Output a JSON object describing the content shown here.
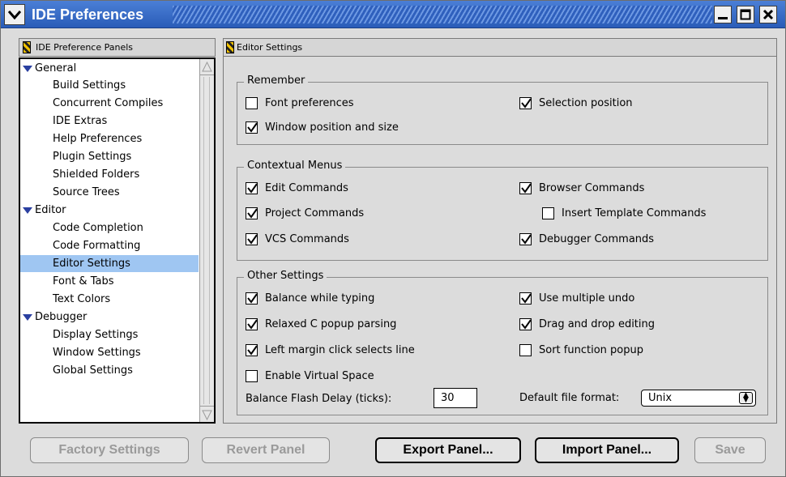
{
  "window": {
    "title": "IDE Preferences"
  },
  "left_panel": {
    "header": "IDE Preference Panels",
    "tree": [
      {
        "type": "category",
        "label": "General"
      },
      {
        "type": "child",
        "label": "Build Settings"
      },
      {
        "type": "child",
        "label": "Concurrent Compiles"
      },
      {
        "type": "child",
        "label": "IDE Extras"
      },
      {
        "type": "child",
        "label": "Help Preferences"
      },
      {
        "type": "child",
        "label": "Plugin Settings"
      },
      {
        "type": "child",
        "label": "Shielded Folders"
      },
      {
        "type": "child",
        "label": "Source Trees"
      },
      {
        "type": "category",
        "label": "Editor"
      },
      {
        "type": "child",
        "label": "Code Completion"
      },
      {
        "type": "child",
        "label": "Code Formatting"
      },
      {
        "type": "child",
        "label": "Editor Settings",
        "selected": true
      },
      {
        "type": "child",
        "label": "Font & Tabs"
      },
      {
        "type": "child",
        "label": "Text Colors"
      },
      {
        "type": "category",
        "label": "Debugger"
      },
      {
        "type": "child",
        "label": "Display Settings"
      },
      {
        "type": "child",
        "label": "Window Settings"
      },
      {
        "type": "child",
        "label": "Global Settings"
      }
    ]
  },
  "right_panel": {
    "header": "Editor Settings",
    "remember": {
      "title": "Remember",
      "font_preferences": {
        "label": "Font preferences",
        "checked": false
      },
      "selection_position": {
        "label": "Selection position",
        "checked": true
      },
      "window_position": {
        "label": "Window position and size",
        "checked": true
      }
    },
    "contextual": {
      "title": "Contextual Menus",
      "edit_commands": {
        "label": "Edit Commands",
        "checked": true
      },
      "browser_commands": {
        "label": "Browser Commands",
        "checked": true
      },
      "project_commands": {
        "label": "Project Commands",
        "checked": true
      },
      "insert_template": {
        "label": "Insert Template Commands",
        "checked": false
      },
      "vcs_commands": {
        "label": "VCS Commands",
        "checked": true
      },
      "debugger_commands": {
        "label": "Debugger Commands",
        "checked": true
      }
    },
    "other": {
      "title": "Other Settings",
      "balance_typing": {
        "label": "Balance while typing",
        "checked": true
      },
      "multiple_undo": {
        "label": "Use multiple undo",
        "checked": true
      },
      "relaxed_popup": {
        "label": "Relaxed C popup parsing",
        "checked": true
      },
      "drag_drop": {
        "label": "Drag and drop editing",
        "checked": true
      },
      "left_margin": {
        "label": "Left margin click selects line",
        "checked": true
      },
      "sort_popup": {
        "label": "Sort function popup",
        "checked": false
      },
      "virtual_space": {
        "label": "Enable Virtual Space",
        "checked": false
      },
      "flash_delay_label": "Balance Flash Delay (ticks):",
      "flash_delay_value": "30",
      "file_format_label": "Default file format:",
      "file_format_value": "Unix"
    }
  },
  "buttons": {
    "factory": "Factory Settings",
    "revert": "Revert Panel",
    "export": "Export Panel...",
    "import": "Import Panel...",
    "save": "Save"
  }
}
